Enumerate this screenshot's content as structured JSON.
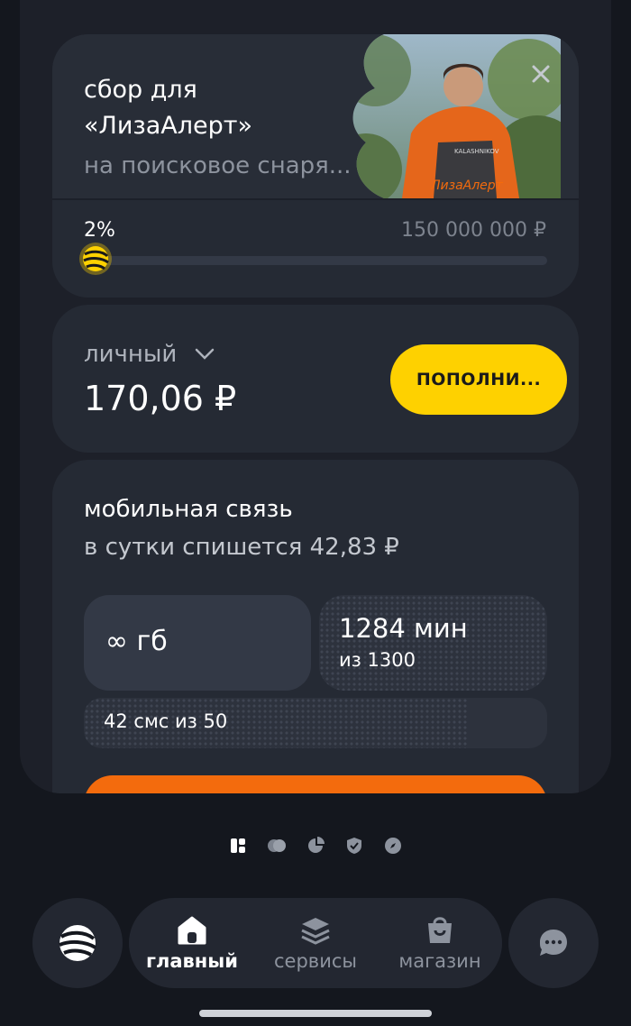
{
  "promo": {
    "title_line1": "сбор для",
    "title_line2": "«ЛизаАлерт»",
    "subtitle": "на поисковое снаря...",
    "photo_jacket_text": "ЛизаАлерт",
    "photo_badge_text": "KALASHNIKOV",
    "progress_label": "2%",
    "progress_fraction": 0.02,
    "goal_amount": "150 000 000 ₽"
  },
  "balance": {
    "label": "личный",
    "amount": "170,06 ₽",
    "topup_label": "ПОПОЛНИ..."
  },
  "mobile": {
    "title": "мобильная связь",
    "daily_charge": "в сутки спишется 42,83 ₽",
    "data_tile": "∞ гб",
    "minutes_value": "1284 мин",
    "minutes_total": "из 1300",
    "sms_text": "42 смс из 50"
  },
  "nav": {
    "home": "главный",
    "services": "сервисы",
    "shop": "магазин"
  },
  "colors": {
    "accent_yellow": "#fed100",
    "accent_orange": "#f36b0d",
    "background": "#14171e",
    "card": "#252a34"
  }
}
